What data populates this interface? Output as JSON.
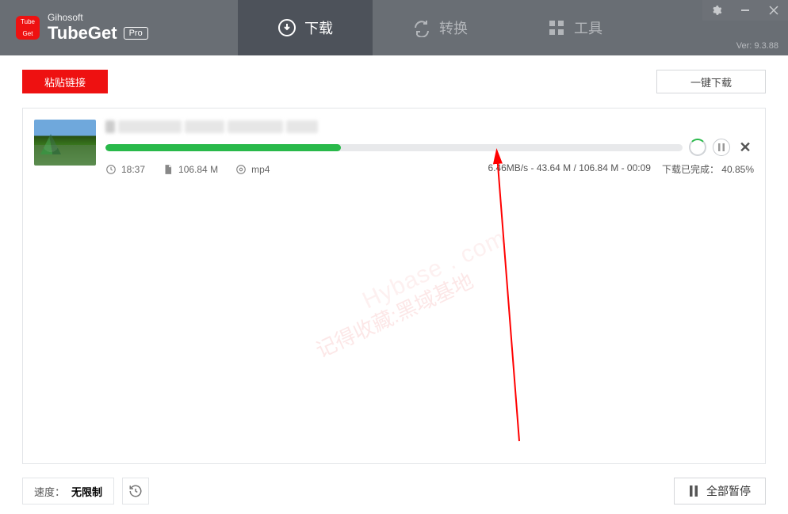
{
  "brand": "Gihosoft",
  "appName": "TubeGet",
  "proBadge": "Pro",
  "version": "Ver: 9.3.88",
  "tabs": {
    "download": "下载",
    "convert": "转换",
    "tools": "工具"
  },
  "toolbar": {
    "paste": "粘贴链接",
    "oneClick": "一键下载"
  },
  "download": {
    "progressPercent": 40.85,
    "duration": "18:37",
    "size": "106.84 M",
    "format": "mp4",
    "speed": "6.46MB/s",
    "downloaded": "43.64 M",
    "total": "106.84 M",
    "remaining": "00:09",
    "statusLabel": "下载已完成：",
    "statusValue": "40.85%"
  },
  "footer": {
    "speedLabel": "速度：",
    "speedValue": "无限制",
    "pauseAll": "全部暂停"
  },
  "watermark": {
    "zh": "记得收藏:黑域基地",
    "en": "Hybase . com"
  }
}
